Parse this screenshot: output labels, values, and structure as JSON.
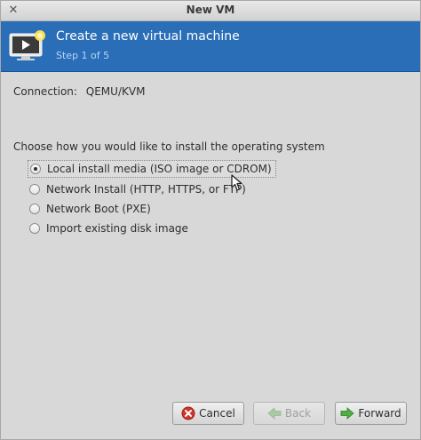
{
  "window": {
    "title": "New VM",
    "close_icon": "close-icon"
  },
  "banner": {
    "title": "Create a new virtual machine",
    "step": "Step 1 of 5",
    "icon": "vm-monitor-icon",
    "bg_color": "#2a6eb8"
  },
  "connection": {
    "label": "Connection:",
    "value": "QEMU/KVM"
  },
  "install": {
    "prompt": "Choose how you would like to install the operating system",
    "options": [
      {
        "label": "Local install media (ISO image or CDROM)",
        "selected": true
      },
      {
        "label": "Network Install (HTTP, HTTPS, or FTP)",
        "selected": false
      },
      {
        "label": "Network Boot (PXE)",
        "selected": false
      },
      {
        "label": "Import existing disk image",
        "selected": false
      }
    ]
  },
  "buttons": {
    "cancel": "Cancel",
    "back": "Back",
    "forward": "Forward"
  }
}
